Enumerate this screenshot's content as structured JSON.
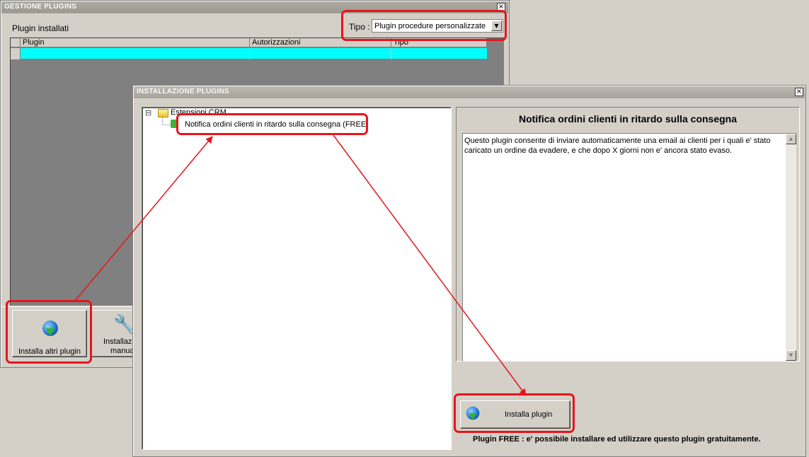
{
  "gestione": {
    "title": "GESTIONE PLUGINS",
    "close_glyph": "×",
    "installed_label": "Plugin installati",
    "tipo_label": "Tipo :",
    "tipo_value": "Plugin procedure personalizzate",
    "dropdown_glyph": "▼",
    "columns": [
      "Plugin",
      "Autorizzazioni",
      "Tipo"
    ],
    "btn_install_other": "Installa altri plugin",
    "btn_manual_line1": "Installazio",
    "btn_manual_line2": "manua"
  },
  "installazione": {
    "title": "INSTALLAZIONE PLUGINS",
    "close_glyph": "×",
    "tree": {
      "expander": "⊟",
      "folder_label": "Estensioni CRM",
      "item_label": "Notifica ordini clienti in ritardo sulla consegna (FREE)"
    },
    "detail_title": "Notifica ordini clienti in ritardo sulla consegna",
    "description": "Questo plugin consente di inviare automaticamente una email ai clienti per i quali e' stato caricato un ordine da evadere, e che dopo X giorni non e' ancora stato evaso.",
    "install_button": "Installa plugin",
    "free_note": "Plugin FREE : e' possibile installare ed utilizzare questo plugin gratuitamente."
  },
  "colors": {
    "highlight": "#e8141c",
    "selection_row": "#00ffff",
    "window_bg": "#d4d0c8",
    "grid_bg": "#808080"
  }
}
